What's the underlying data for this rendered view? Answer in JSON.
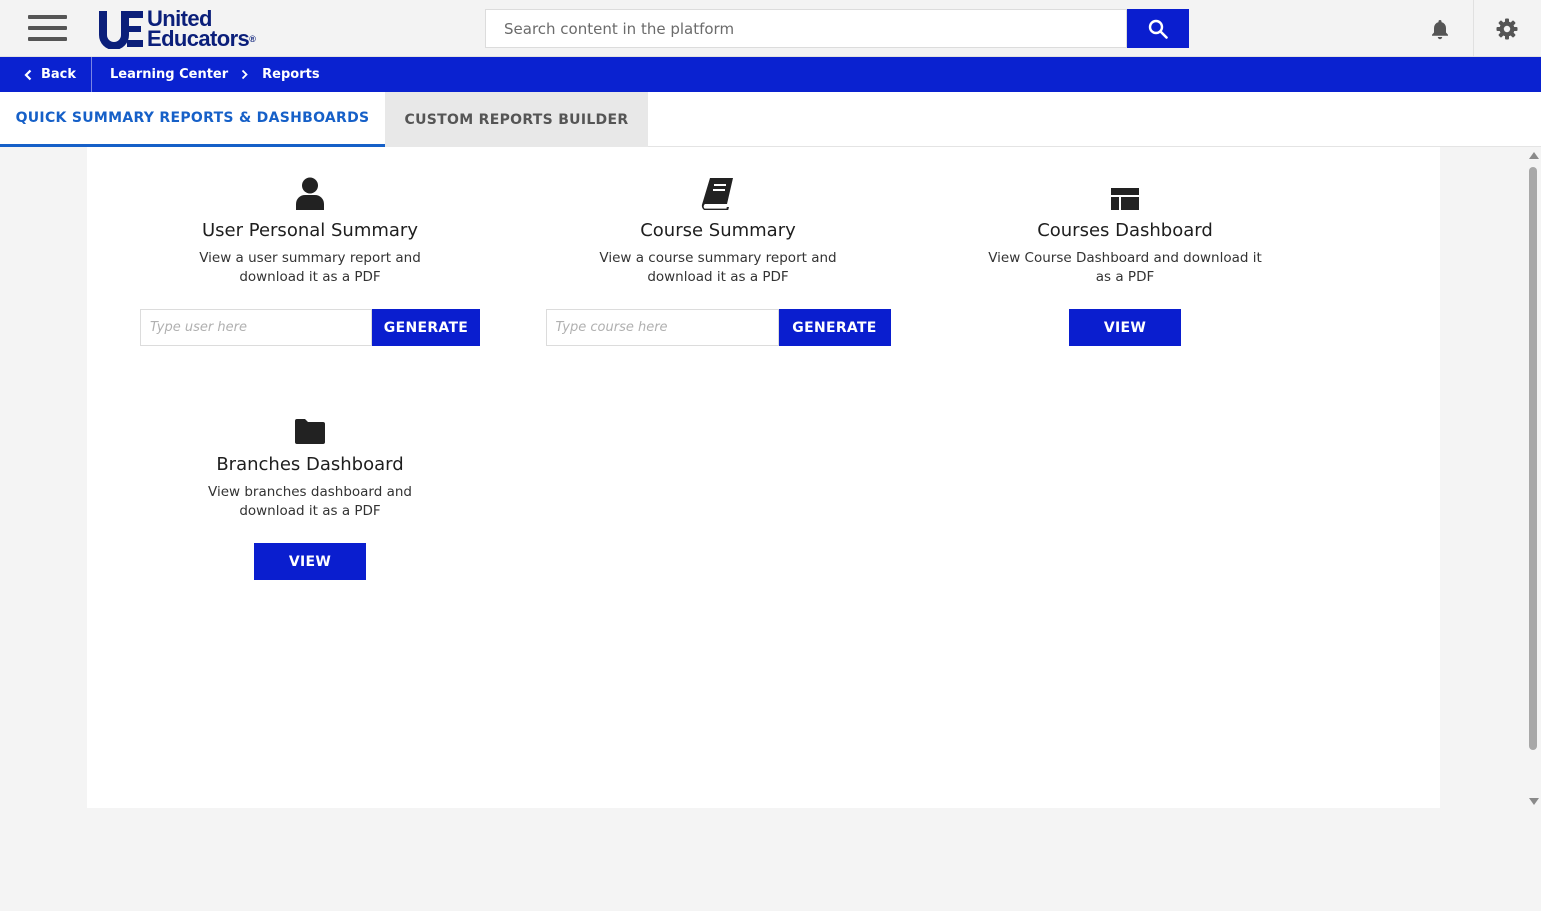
{
  "header": {
    "menu_icon": "hamburger-menu-icon",
    "logo": {
      "line1": "United",
      "line2": "Educators",
      "mark": "UE",
      "reg": "®"
    },
    "search": {
      "placeholder": "Search content in the platform",
      "value": ""
    },
    "search_icon": "search-icon",
    "notification_icon": "bell-icon",
    "settings_icon": "gear-icon"
  },
  "breadcrumb": {
    "back_label": "Back",
    "items": [
      "Learning Center",
      "Reports"
    ]
  },
  "tabs": [
    {
      "label": "QUICK SUMMARY REPORTS & DASHBOARDS",
      "active": true
    },
    {
      "label": "CUSTOM REPORTS BUILDER",
      "active": false
    }
  ],
  "cards": {
    "user": {
      "icon": "user-icon",
      "title": "User Personal Summary",
      "desc_line1": "View a user summary report and",
      "desc_line2": "download it as a PDF",
      "placeholder": "Type user here",
      "button": "GENERATE"
    },
    "course": {
      "icon": "book-icon",
      "title": "Course Summary",
      "desc_line1": "View a course summary report and",
      "desc_line2": "download it as a PDF",
      "placeholder": "Type course here",
      "button": "GENERATE"
    },
    "courses_dashboard": {
      "icon": "dashboard-icon",
      "title": "Courses Dashboard",
      "desc_line1": "View Course Dashboard and download it",
      "desc_line2": "as a PDF",
      "button": "VIEW"
    },
    "branches_dashboard": {
      "icon": "folder-icon",
      "title": "Branches Dashboard",
      "desc_line1": "View branches dashboard and",
      "desc_line2": "download it as a PDF",
      "button": "VIEW"
    }
  },
  "colors": {
    "brand_blue": "#0a1ecf",
    "breadcrumb_bg": "#0a22d0",
    "active_tab": "#1660c8",
    "logo_navy": "#0b1f7a"
  }
}
